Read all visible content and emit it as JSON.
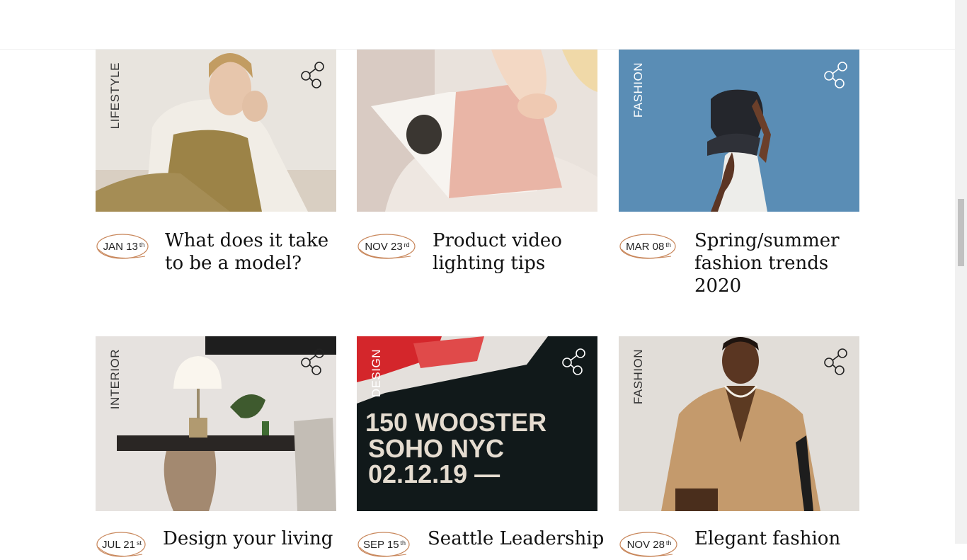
{
  "cards": [
    {
      "category": "LIFESTYLE",
      "date_month": "JAN 13",
      "date_suffix": "th",
      "title": "What does it take to be a model?"
    },
    {
      "category": "",
      "date_month": "NOV 23",
      "date_suffix": "rd",
      "title": "Product video lighting tips"
    },
    {
      "category": "FASHION",
      "date_month": "MAR 08",
      "date_suffix": "th",
      "title": "Spring/summer fashion trends 2020"
    },
    {
      "category": "INTERIOR",
      "date_month": "JUL 21",
      "date_suffix": "st",
      "title": "Design your living"
    },
    {
      "category": "DESIGN",
      "date_month": "SEP 15",
      "date_suffix": "th",
      "title": "Seattle Leadership"
    },
    {
      "category": "FASHION",
      "date_month": "NOV 28",
      "date_suffix": "th",
      "title": "Elegant fashion"
    }
  ],
  "poster": {
    "line1": "150 WOOSTER",
    "line2": "SOHO NYC",
    "line3": "02.12.19 —"
  },
  "share_icon": "share-icon",
  "colors": {
    "accent": "#c8865a",
    "text": "#111111"
  }
}
